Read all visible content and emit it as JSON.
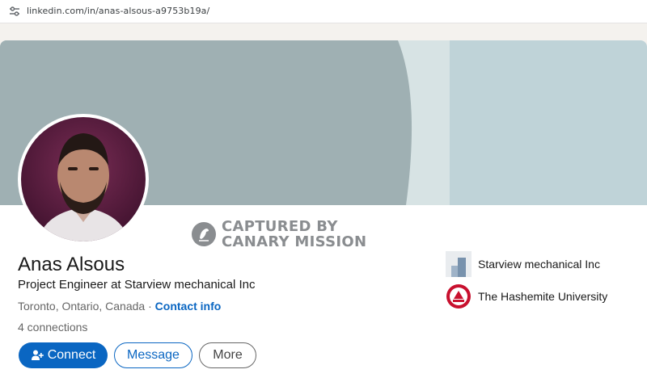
{
  "browser": {
    "url": "linkedin.com/in/anas-alsous-a9753b19a/",
    "site_info_icon": "tune-icon"
  },
  "profile": {
    "name": "Anas Alsous",
    "headline": "Project Engineer at Starview mechanical Inc",
    "location": "Toronto, Ontario, Canada",
    "separator": " · ",
    "contact_info_label": "Contact info",
    "connections": "4 connections"
  },
  "watermark": {
    "line1": "CAPTURED BY",
    "line2": "CANARY MISSION"
  },
  "actions": {
    "connect_label": "Connect",
    "message_label": "Message",
    "more_label": "More"
  },
  "organizations": [
    {
      "name": "Starview mechanical Inc",
      "logo": "company-logo"
    },
    {
      "name": "The Hashemite University",
      "logo": "university-logo"
    }
  ],
  "colors": {
    "accent": "#0a66c2",
    "banner_dark": "#9fb0b3",
    "banner_light": "#bfd3d8"
  }
}
